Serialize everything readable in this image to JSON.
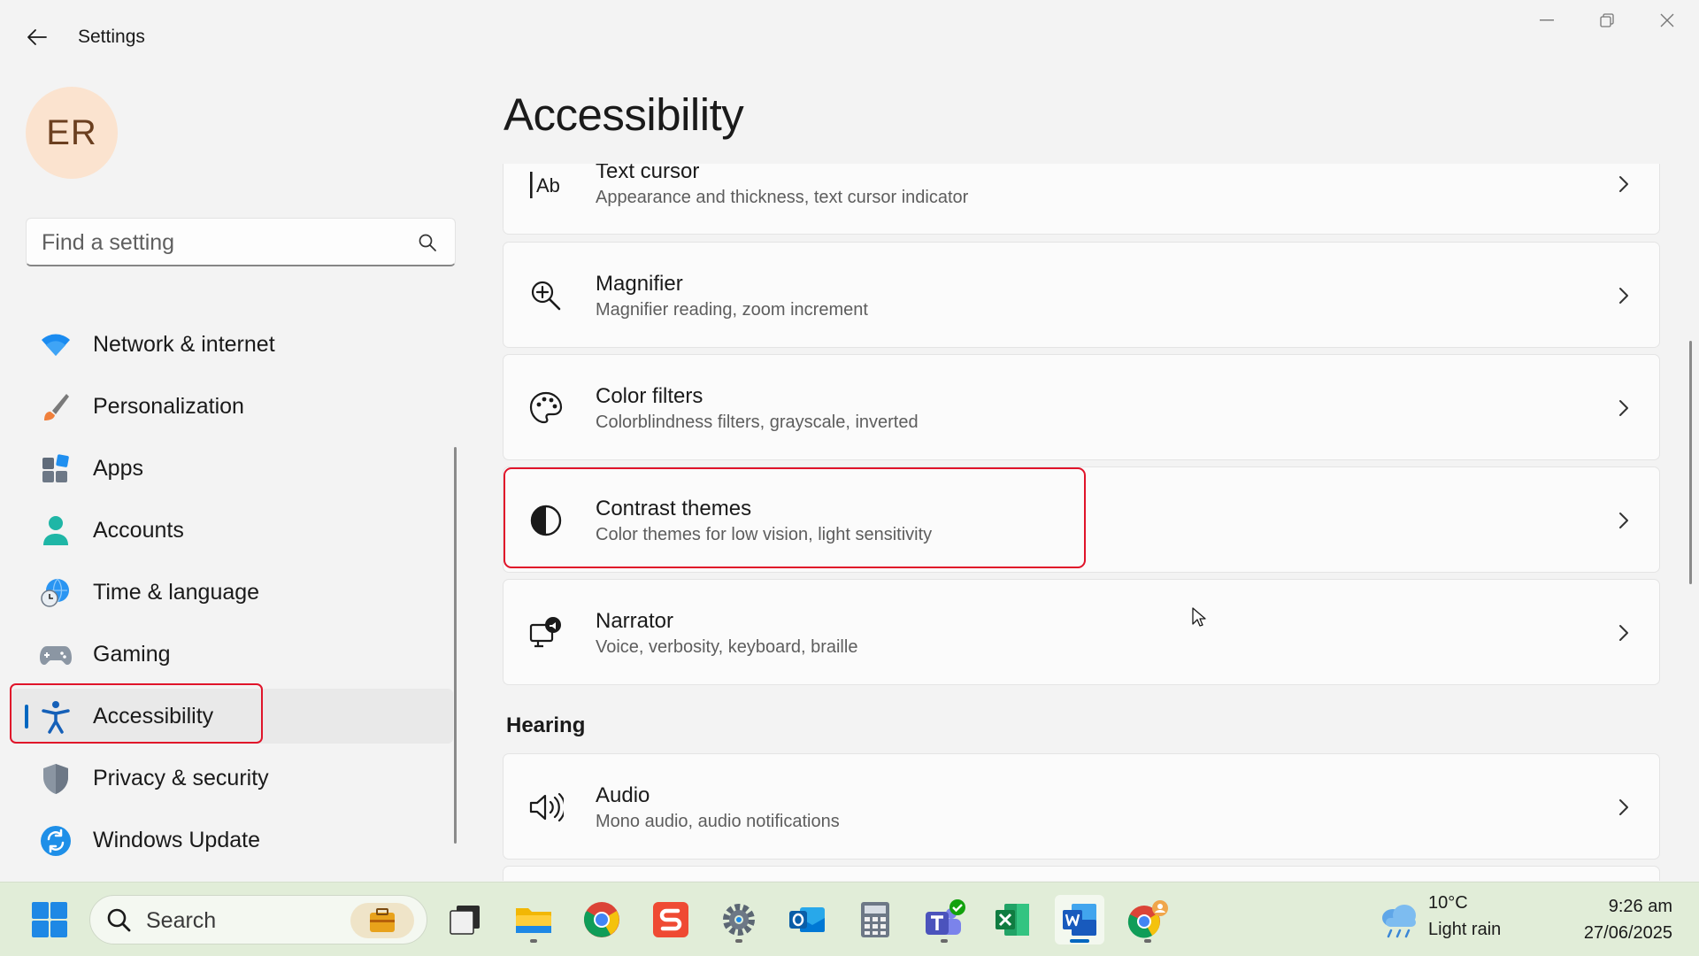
{
  "window": {
    "title": "Settings",
    "controls": {
      "minimize": "minimize-icon",
      "maximize": "restore-icon",
      "close": "close-icon"
    }
  },
  "user": {
    "initials": "ER"
  },
  "search": {
    "placeholder": "Find a setting"
  },
  "sidebar": {
    "items": [
      {
        "label": "Network & internet",
        "icon": "wifi-icon"
      },
      {
        "label": "Personalization",
        "icon": "paintbrush-icon"
      },
      {
        "label": "Apps",
        "icon": "apps-icon"
      },
      {
        "label": "Accounts",
        "icon": "person-icon"
      },
      {
        "label": "Time & language",
        "icon": "globe-clock-icon"
      },
      {
        "label": "Gaming",
        "icon": "gamepad-icon"
      },
      {
        "label": "Accessibility",
        "icon": "accessibility-icon",
        "selected": true
      },
      {
        "label": "Privacy & security",
        "icon": "shield-icon"
      },
      {
        "label": "Windows Update",
        "icon": "update-icon"
      }
    ]
  },
  "main": {
    "title": "Accessibility",
    "cards": [
      {
        "title": "Text cursor",
        "subtitle": "Appearance and thickness, text cursor indicator",
        "icon": "text-cursor-icon"
      },
      {
        "title": "Magnifier",
        "subtitle": "Magnifier reading, zoom increment",
        "icon": "magnifier-icon"
      },
      {
        "title": "Color filters",
        "subtitle": "Colorblindness filters, grayscale, inverted",
        "icon": "palette-icon"
      },
      {
        "title": "Contrast themes",
        "subtitle": "Color themes for low vision, light sensitivity",
        "icon": "contrast-icon"
      },
      {
        "title": "Narrator",
        "subtitle": "Voice, verbosity, keyboard, braille",
        "icon": "narrator-icon"
      }
    ],
    "sections": [
      {
        "label": "Hearing"
      }
    ],
    "hearing_cards": [
      {
        "title": "Audio",
        "subtitle": "Mono audio, audio notifications",
        "icon": "speaker-icon"
      }
    ]
  },
  "taskbar": {
    "search_placeholder": "Search",
    "apps": [
      "start-icon",
      "briefcase-icon",
      "task-view-icon",
      "file-explorer-icon",
      "chrome-icon",
      "snagit-icon",
      "settings-icon",
      "outlook-icon",
      "calculator-icon",
      "teams-icon",
      "excel-icon",
      "word-icon",
      "chrome-profile-icon"
    ],
    "weather": {
      "temperature": "10°C",
      "condition": "Light rain"
    },
    "clock": {
      "time": "9:26 am",
      "date": "27/06/2025"
    }
  },
  "colors": {
    "accent": "#0067c0",
    "highlight_outline": "#e0142a",
    "taskbar_bg": "#e1edd8"
  }
}
